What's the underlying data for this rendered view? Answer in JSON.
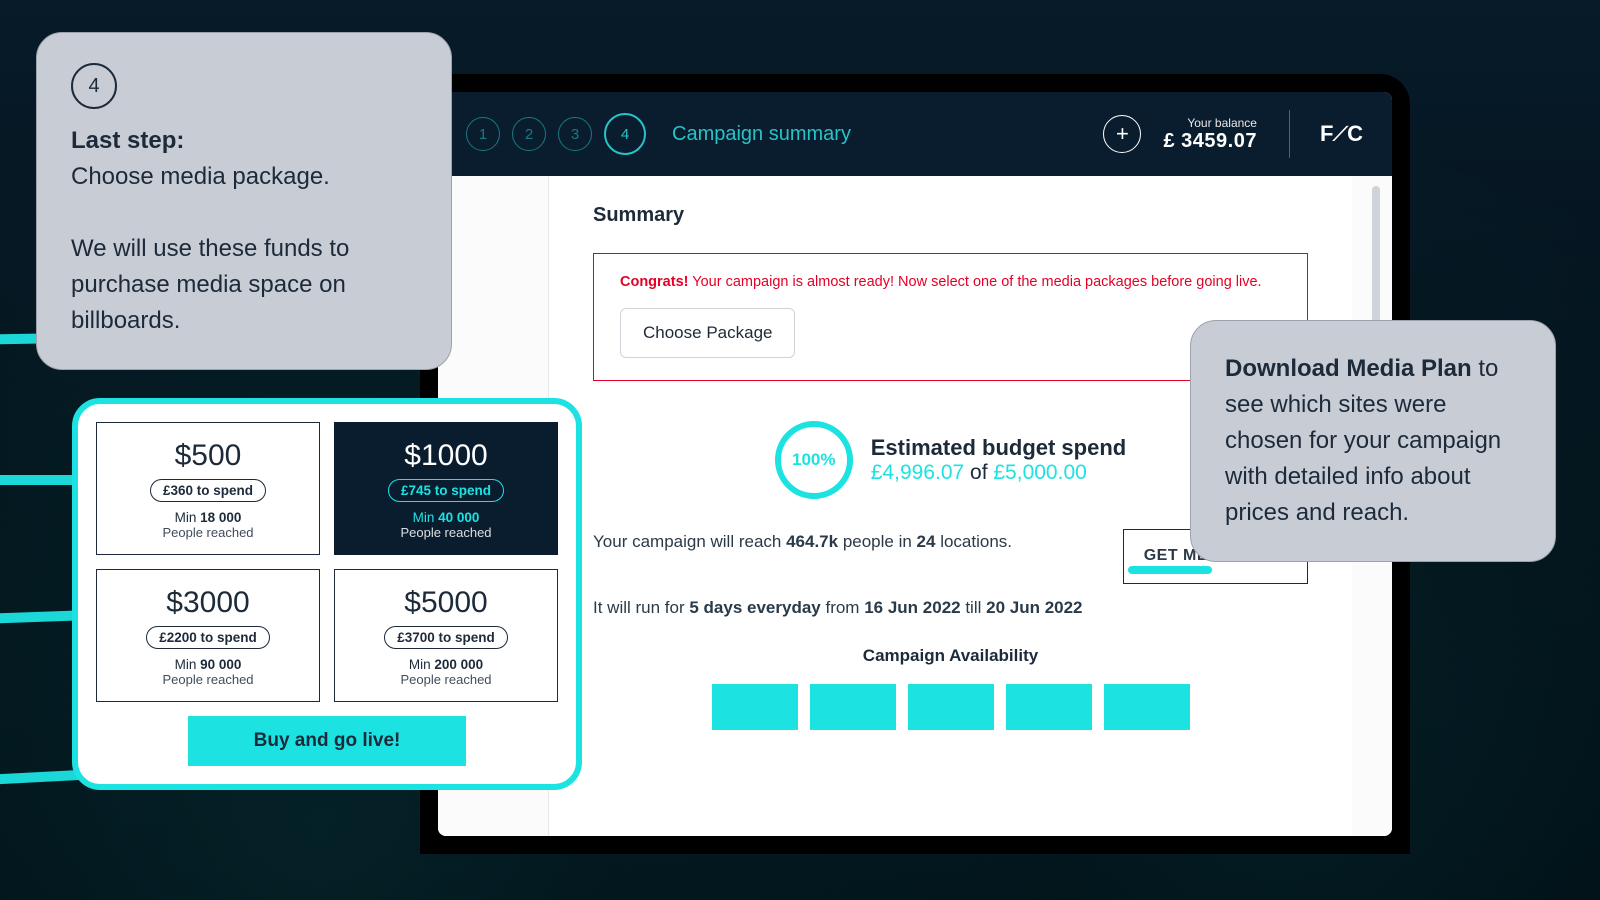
{
  "topbar": {
    "steps": [
      "1",
      "2",
      "3",
      "4"
    ],
    "active_step_index": 3,
    "title": "Campaign summary",
    "balance_label": "Your balance",
    "balance_value": "£ 3459.07",
    "logo_left": "F",
    "logo_right": "C"
  },
  "summary": {
    "heading": "Summary",
    "alert_lead": "Congrats!",
    "alert_rest": " Your campaign is almost ready! Now select one of the media packages before going live.",
    "choose_button": "Choose Package",
    "progress_pct": "100%",
    "budget_title": "Estimated budget spend",
    "budget_spent": "£4,996.07",
    "budget_of": " of ",
    "budget_total": "£5,000.00",
    "reach_pre": "Your campaign will reach ",
    "reach_people": "464.7k",
    "reach_mid": " people in ",
    "reach_locs": "24",
    "reach_post": " locations.",
    "media_plan_button": "GET MEDIA PLAN",
    "run_pre": "It will run for ",
    "run_dur": "5 days everyday",
    "run_mid": " from ",
    "run_from": "16 Jun 2022",
    "run_mid2": " till ",
    "run_to": "20 Jun 2022",
    "avail_title": "Campaign Availability"
  },
  "callout_left": {
    "step": "4",
    "line1": "Last step:",
    "line2": "Choose media package.",
    "para2": "We will use these funds to purchase media space on billboards."
  },
  "callout_right": {
    "title": "Download Media Plan",
    "body": "to see which sites were chosen for your campaign with detailed info about prices and reach."
  },
  "packages": {
    "items": [
      {
        "price": "$500",
        "spend": "£360 to spend",
        "reach_label": "Min ",
        "reach_n": "18 000",
        "sub": "People reached"
      },
      {
        "price": "$1000",
        "spend": "£745 to spend",
        "reach_label": "Min ",
        "reach_n": "40 000",
        "sub": "People reached"
      },
      {
        "price": "$3000",
        "spend": "£2200 to spend",
        "reach_label": "Min ",
        "reach_n": "90 000",
        "sub": "People reached"
      },
      {
        "price": "$5000",
        "spend": "£3700 to spend",
        "reach_label": "Min ",
        "reach_n": "200 000",
        "sub": "People reached"
      }
    ],
    "selected_index": 1,
    "buy_label": "Buy and go live!"
  }
}
